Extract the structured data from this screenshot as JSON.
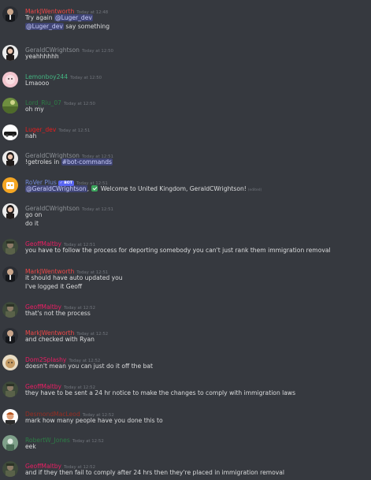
{
  "colors": {
    "background": "#36393f",
    "text": "#dcddde",
    "timestamp": "#72767d",
    "mention_bg": "#4d5492",
    "mention_text": "#c9cdfb"
  },
  "messages": [
    {
      "author": "MarkJWentworth",
      "author_color": "#f04747",
      "timestamp": "Today at 12:48",
      "avatar": "avatar-suit-man",
      "lines": [
        [
          {
            "t": "Try again "
          },
          {
            "t": "@Luger_dev",
            "m": true
          }
        ],
        [
          {
            "t": "@Luger_dev",
            "m": true
          },
          {
            "t": " say something"
          }
        ]
      ]
    },
    {
      "author": "GeraldCWrightson",
      "author_color": "#8e9297",
      "timestamp": "Today at 12:50",
      "avatar": "avatar-woman-dark-hair",
      "lines": [
        [
          {
            "t": "yeahhhhhh"
          }
        ]
      ]
    },
    {
      "author": "Lemonboy244",
      "author_color": "#43b581",
      "timestamp": "Today at 12:50",
      "avatar": "avatar-pink-face",
      "lines": [
        [
          {
            "t": "Lmaooo"
          }
        ]
      ]
    },
    {
      "author": "Lord_Riu_07",
      "author_color": "#2d7d46",
      "timestamp": "Today at 12:50",
      "avatar": "avatar-green-landscape",
      "lines": [
        [
          {
            "t": "oh my"
          }
        ]
      ]
    },
    {
      "author": "Luger_dev",
      "author_color": "#e91e1e",
      "timestamp": "Today at 12:51",
      "avatar": "avatar-car",
      "lines": [
        [
          {
            "t": "nah"
          }
        ]
      ]
    },
    {
      "author": "GeraldCWrightson",
      "author_color": "#8e9297",
      "timestamp": "Today at 12:51",
      "avatar": "avatar-woman-dark-hair",
      "lines": [
        [
          {
            "t": "!getroles in "
          },
          {
            "t": "#bot-commands",
            "m": true
          }
        ]
      ]
    },
    {
      "author": "RoVer Plus",
      "author_color": "#7289da",
      "timestamp": "Today at 12:51",
      "avatar": "avatar-rover-bot",
      "badge": "✓ BOT",
      "lines": [
        [
          {
            "t": "@GeraldCWrightson",
            "m": true
          },
          {
            "t": ", "
          },
          {
            "check": true
          },
          {
            "t": " Welcome to United Kingdom, GeraldCWrightson!"
          },
          {
            "edited": "(edited)"
          }
        ]
      ]
    },
    {
      "author": "GeraldCWrightson",
      "author_color": "#8e9297",
      "timestamp": "Today at 12:51",
      "avatar": "avatar-woman-dark-hair",
      "lines": [
        [
          {
            "t": "go on"
          }
        ],
        [
          {
            "t": "do it"
          }
        ]
      ]
    },
    {
      "author": "GeoffMaltby",
      "author_color": "#e91e63",
      "timestamp": "Today at 12:51",
      "avatar": "avatar-soldier",
      "lines": [
        [
          {
            "t": "you have to follow the process for deporting somebody you can't just rank them immigration removal"
          }
        ]
      ]
    },
    {
      "author": "MarkJWentworth",
      "author_color": "#f04747",
      "timestamp": "Today at 12:51",
      "avatar": "avatar-suit-man",
      "lines": [
        [
          {
            "t": "it should have auto updated you"
          }
        ],
        [
          {
            "t": "I've logged it Geoff"
          }
        ]
      ]
    },
    {
      "author": "GeoffMaltby",
      "author_color": "#e91e63",
      "timestamp": "Today at 12:52",
      "avatar": "avatar-soldier",
      "lines": [
        [
          {
            "t": "that's not the process"
          }
        ]
      ]
    },
    {
      "author": "MarkJWentworth",
      "author_color": "#f04747",
      "timestamp": "Today at 12:52",
      "avatar": "avatar-suit-man",
      "lines": [
        [
          {
            "t": "and checked with Ryan"
          }
        ]
      ]
    },
    {
      "author": "Dom2Splashy",
      "author_color": "#e91e63",
      "timestamp": "Today at 12:52",
      "avatar": "avatar-dog",
      "lines": [
        [
          {
            "t": "doesn't mean you can just do it off the bat"
          }
        ]
      ]
    },
    {
      "author": "GeoffMaltby",
      "author_color": "#e91e63",
      "timestamp": "Today at 12:52",
      "avatar": "avatar-soldier",
      "lines": [
        [
          {
            "t": "they have to be sent a 24 hr notice to make the changes to comply with immigration laws"
          }
        ]
      ]
    },
    {
      "author": "DesmondMacLeod",
      "author_color": "#992d22",
      "timestamp": "Today at 12:52",
      "avatar": "avatar-ginger-man",
      "lines": [
        [
          {
            "t": "mark how many people have you done this to"
          }
        ]
      ]
    },
    {
      "author": "RobertW_Jones",
      "author_color": "#2d7d46",
      "timestamp": "Today at 12:52",
      "avatar": "avatar-green-figure",
      "lines": [
        [
          {
            "t": "eek"
          }
        ]
      ]
    },
    {
      "author": "GeoffMaltby",
      "author_color": "#e91e63",
      "timestamp": "Today at 12:52",
      "avatar": "avatar-soldier",
      "lines": [
        [
          {
            "t": "and if they then fail to comply after 24 hrs then they're placed in immigration removal"
          }
        ]
      ]
    }
  ]
}
